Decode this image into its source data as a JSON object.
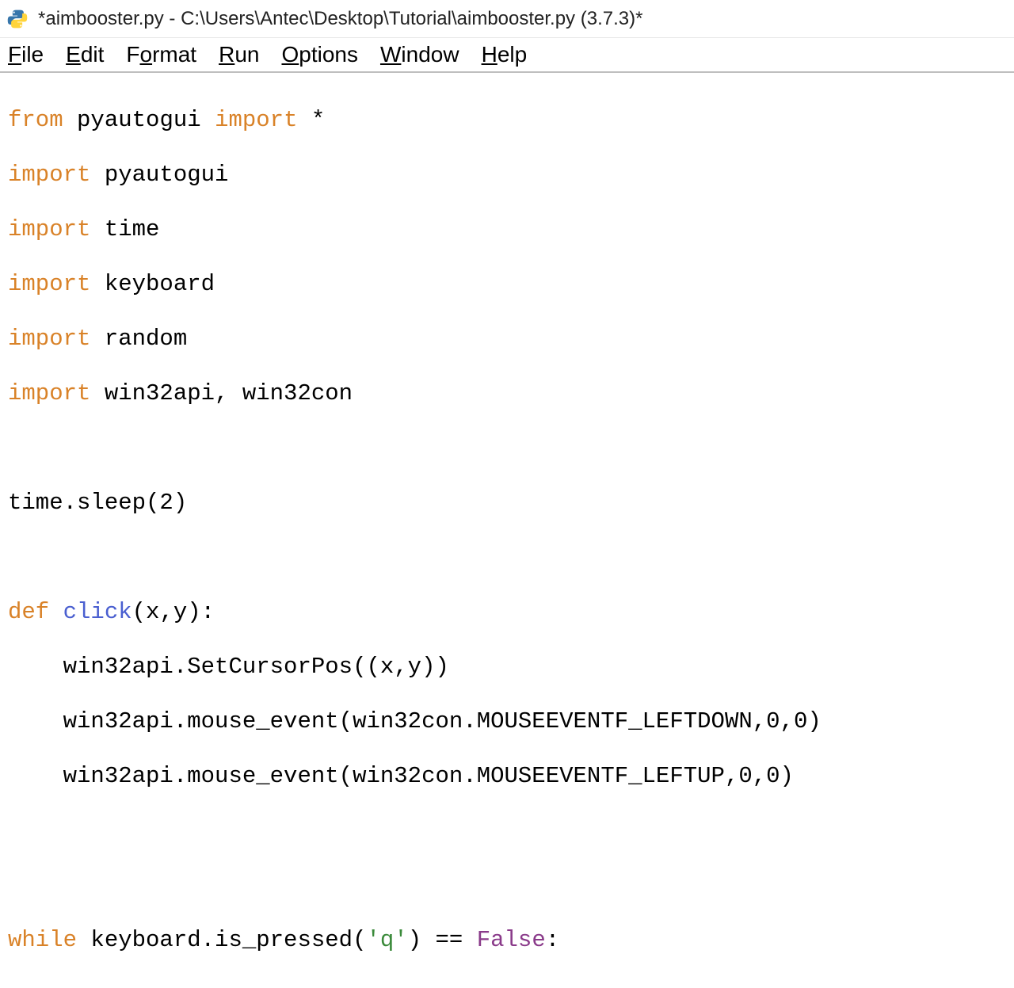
{
  "window": {
    "title": "*aimbooster.py - C:\\Users\\Antec\\Desktop\\Tutorial\\aimbooster.py (3.7.3)*"
  },
  "menubar": {
    "file": "File",
    "edit": "Edit",
    "format": "Format",
    "run": "Run",
    "options": "Options",
    "window": "Window",
    "help": "Help"
  },
  "code": {
    "l01_from": "from",
    "l01_mod": " pyautogui ",
    "l01_import": "import",
    "l01_rest": " *",
    "l02_import": "import",
    "l02_rest": " pyautogui",
    "l03_import": "import",
    "l03_rest": " time",
    "l04_import": "import",
    "l04_rest": " keyboard",
    "l05_import": "import",
    "l05_rest": " random",
    "l06_import": "import",
    "l06_rest": " win32api, win32con",
    "l07_blank": "",
    "l08": "time.sleep(2)",
    "l09_blank": "",
    "l10_def": "def",
    "l10_sp": " ",
    "l10_fn": "click",
    "l10_rest": "(x,y):",
    "l11": "    win32api.SetCursorPos((x,y))",
    "l12": "    win32api.mouse_event(win32con.MOUSEEVENTF_LEFTDOWN,0,0)",
    "l13": "    win32api.mouse_event(win32con.MOUSEEVENTF_LEFTUP,0,0)",
    "l14_blank": "",
    "l15_blank": "",
    "l16_while": "while",
    "l16_mid1": " keyboard.is_pressed(",
    "l16_str": "'q'",
    "l16_mid2": ") == ",
    "l16_false": "False",
    "l16_end": ":"
  }
}
